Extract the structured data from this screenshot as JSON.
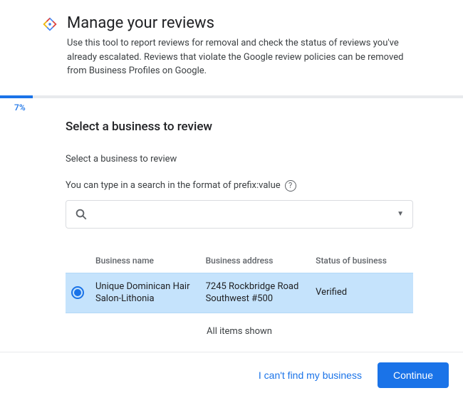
{
  "header": {
    "title": "Manage your reviews",
    "subtitle": "Use this tool to report reviews for removal and check the status of reviews you've already escalated. Reviews that violate the Google review policies can be removed from Business Profiles on Google."
  },
  "progress": {
    "percent_label": "7%",
    "percent_value": 7
  },
  "section": {
    "title": "Select a business to review",
    "subtitle": "Select a business to review",
    "hint": "You can type in a search in the format of prefix:value"
  },
  "search": {
    "placeholder": ""
  },
  "table": {
    "columns": {
      "name": "Business name",
      "address": "Business address",
      "status": "Status of business"
    },
    "rows": [
      {
        "selected": true,
        "name": "Unique Dominican Hair Salon-Lithonia",
        "address": "7245 Rockbridge Road Southwest #500",
        "status": "Verified"
      }
    ],
    "footer": "All items shown"
  },
  "footer": {
    "cant_find": "I can't find my business",
    "continue": "Continue"
  }
}
